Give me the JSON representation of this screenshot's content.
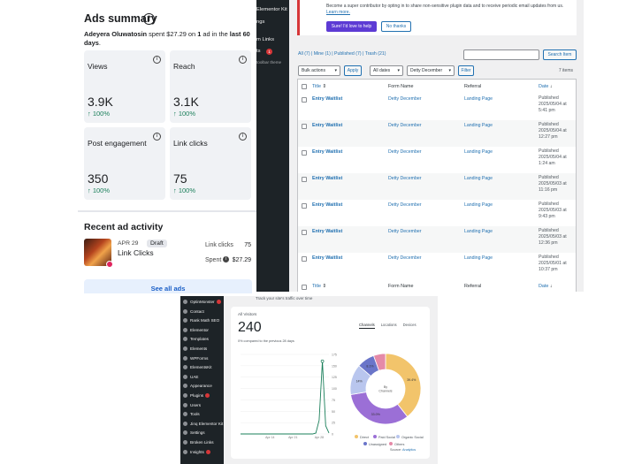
{
  "ads_panel": {
    "title": "Ads summary",
    "summary_parts": [
      "Adeyera Oluwatosin",
      " spent ",
      "$27.29",
      " on ",
      "1",
      " ad in the ",
      "last 60 days",
      "."
    ],
    "metrics": [
      {
        "label": "Views",
        "value": "3.9K",
        "change": "100%"
      },
      {
        "label": "Reach",
        "value": "3.1K",
        "change": "100%"
      },
      {
        "label": "Post engagement",
        "value": "350",
        "change": "100%"
      },
      {
        "label": "Link clicks",
        "value": "75",
        "change": "100%"
      }
    ],
    "recent_title": "Recent ad activity",
    "ad": {
      "date": "APR 29",
      "status": "Draft",
      "name": "Link Clicks",
      "link_clicks_label": "Link clicks",
      "link_clicks": "75",
      "spent_label": "Spent",
      "spent": "$27.29"
    },
    "see_all": "See all ads"
  },
  "wp_entries": {
    "sidebar": [
      "Elementor Kit",
      "ngs",
      "m Links",
      "ts",
      "toolbar theme"
    ],
    "sidebar_badge": "1",
    "notice_text": "Become a super contributor by opting in to share non-sensitive plugin data and to receive periodic email updates from us.",
    "notice_link": "Learn more.",
    "notice_yes": "Sure! I'd love to help",
    "notice_no": "No thanks",
    "filters_text": "All (7) | Mine (1) | Published (7) | Trash (21)",
    "search_button": "Search Item",
    "bulk_actions": "Bulk actions",
    "apply": "Apply",
    "all_dates": "All dates",
    "form_filter": "Detty December",
    "filter_button": "Filter",
    "item_count": "7 items",
    "columns": {
      "title": "Title",
      "form": "Form Name",
      "referral": "Referral",
      "date": "Date"
    },
    "rows": [
      {
        "title": "Entry Waitlist",
        "form": "Detty December",
        "referral": "Landing Page",
        "status": "Published",
        "date": "2025/05/04 at",
        "time": "5:41 pm"
      },
      {
        "title": "Entry Waitlist",
        "form": "Detty December",
        "referral": "Landing Page",
        "status": "Published",
        "date": "2025/05/04 at",
        "time": "12:27 pm"
      },
      {
        "title": "Entry Waitlist",
        "form": "Detty December",
        "referral": "Landing Page",
        "status": "Published",
        "date": "2025/05/04 at",
        "time": "1:24 am"
      },
      {
        "title": "Entry Waitlist",
        "form": "Detty December",
        "referral": "Landing Page",
        "status": "Published",
        "date": "2025/05/03 at",
        "time": "11:16 pm"
      },
      {
        "title": "Entry Waitlist",
        "form": "Detty December",
        "referral": "Landing Page",
        "status": "Published",
        "date": "2025/05/03 at",
        "time": "9:43 pm"
      },
      {
        "title": "Entry Waitlist",
        "form": "Detty December",
        "referral": "Landing Page",
        "status": "Published",
        "date": "2025/05/03 at",
        "time": "12:36 pm"
      },
      {
        "title": "Entry Waitlist",
        "form": "Detty December",
        "referral": "Landing Page",
        "status": "Published",
        "date": "2025/05/01 at",
        "time": "10:37 pm"
      }
    ]
  },
  "wp_analytics": {
    "top_text": "Track your site's traffic over time",
    "sidebar": [
      {
        "label": "OptinMonster",
        "badge": true
      },
      {
        "label": "Contact",
        "badge": false
      },
      {
        "label": "Rank Math SEO",
        "badge": false
      },
      {
        "label": "Elementor",
        "badge": false
      },
      {
        "label": "Templates",
        "badge": false
      },
      {
        "label": "Elements",
        "badge": false
      },
      {
        "label": "WPForms",
        "badge": false
      },
      {
        "label": "ElementsKit",
        "badge": false
      },
      {
        "label": "UAE",
        "badge": false
      },
      {
        "label": "Appearance",
        "badge": false
      },
      {
        "label": "Plugins",
        "badge": true
      },
      {
        "label": "Users",
        "badge": false
      },
      {
        "label": "Tools",
        "badge": false
      },
      {
        "label": "Jinq Elementor Kit",
        "badge": false
      },
      {
        "label": "Settings",
        "badge": false
      },
      {
        "label": "Broken Links",
        "badge": false
      },
      {
        "label": "Insights",
        "badge": true
      }
    ],
    "all_visitors_label": "All Visitors",
    "total": "240",
    "comparison": "0% compared to the previous 28 days",
    "tabs": [
      "Channels",
      "Locations",
      "Devices"
    ],
    "source": "Source:",
    "source_link": "Analytics"
  },
  "chart_data": [
    {
      "type": "line",
      "x_ticks": [
        "Apr 14",
        "Apr 21",
        "Apr 28"
      ],
      "y_ticks": [
        0,
        25,
        50,
        75,
        100,
        125,
        150,
        175
      ],
      "ylim": [
        0,
        175
      ],
      "values": [
        0,
        0,
        0,
        0,
        0,
        0,
        0,
        0,
        0,
        0,
        0,
        0,
        0,
        0,
        0,
        0,
        0,
        0,
        0,
        0,
        0,
        0,
        0,
        2,
        30,
        160,
        18,
        2
      ],
      "color": "#1a7f5a"
    },
    {
      "type": "pie",
      "center_label": "By Channels",
      "slices": [
        {
          "label": "Direct",
          "value": 39.4,
          "color": "#f2c46b"
        },
        {
          "label": "Paid Social",
          "value": 33.0,
          "color": "#9b6fd6"
        },
        {
          "label": "Organic Social",
          "value": 14.0,
          "color": "#b9c6ee"
        },
        {
          "label": "Unassigned",
          "value": 8.1,
          "color": "#6a75c9"
        },
        {
          "label": "Others",
          "value": 5.5,
          "color": "#e58aa8"
        }
      ],
      "slice_labels": [
        "39.4%",
        "33.0%",
        "14%",
        "8.1%",
        ""
      ]
    }
  ]
}
